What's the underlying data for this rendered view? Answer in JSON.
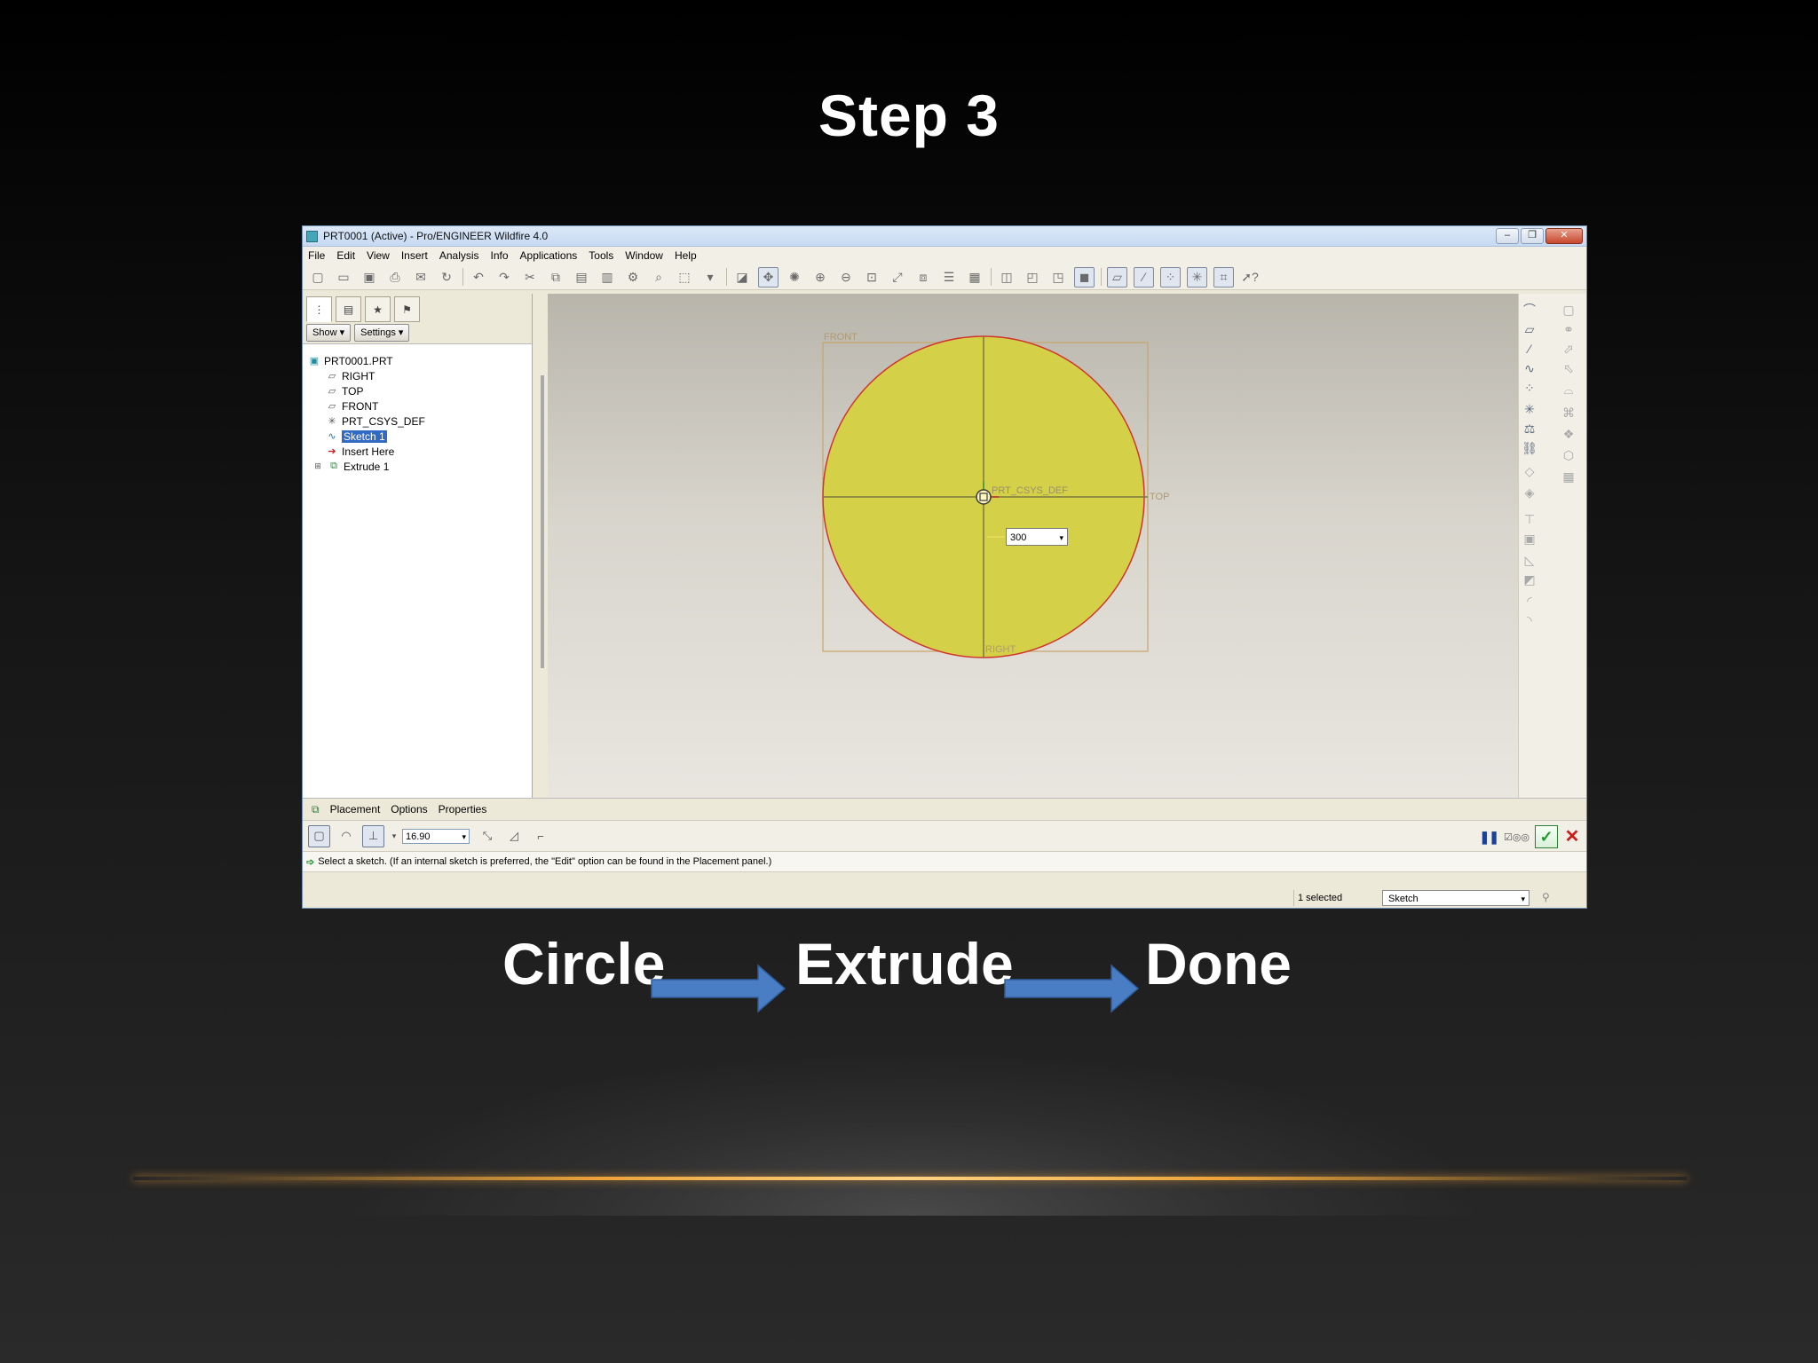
{
  "slide": {
    "title": "Step 3",
    "flow": [
      "Circle",
      "Extrude",
      "Done"
    ]
  },
  "window": {
    "title": "PRT0001 (Active) - Pro/ENGINEER Wildfire 4.0",
    "menu": [
      "File",
      "Edit",
      "View",
      "Insert",
      "Analysis",
      "Info",
      "Applications",
      "Tools",
      "Window",
      "Help"
    ]
  },
  "model_tree": {
    "show_label": "Show",
    "settings_label": "Settings",
    "items": [
      {
        "label": "PRT0001.PRT",
        "icon": "part-icon"
      },
      {
        "label": "RIGHT",
        "icon": "datum-plane-icon"
      },
      {
        "label": "TOP",
        "icon": "datum-plane-icon"
      },
      {
        "label": "FRONT",
        "icon": "datum-plane-icon"
      },
      {
        "label": "PRT_CSYS_DEF",
        "icon": "csys-icon"
      },
      {
        "label": "Sketch 1",
        "icon": "sketch-icon",
        "selected": true
      },
      {
        "label": "Insert Here",
        "icon": "insert-arrow-icon"
      },
      {
        "label": "Extrude 1",
        "icon": "extrude-icon"
      }
    ]
  },
  "canvas": {
    "datum_front": "FRONT",
    "datum_top": "TOP",
    "datum_right": "RIGHT",
    "csys": "PRT_CSYS_DEF",
    "dimension_value": "300",
    "circle_fill": "#d4d048",
    "circle_stroke": "#d0342c"
  },
  "dashboard": {
    "tabs": [
      "Placement",
      "Options",
      "Properties"
    ],
    "depth_value": "16.90",
    "message": "Select a sketch. (If an internal sketch is preferred, the \"Edit\" option can be found in the Placement panel.)"
  },
  "status_bar": {
    "selected": "1 selected",
    "filter": "Sketch"
  },
  "colors": {
    "arrow_blue": "#4a7ec4",
    "accent_gold": "#ffb444"
  }
}
